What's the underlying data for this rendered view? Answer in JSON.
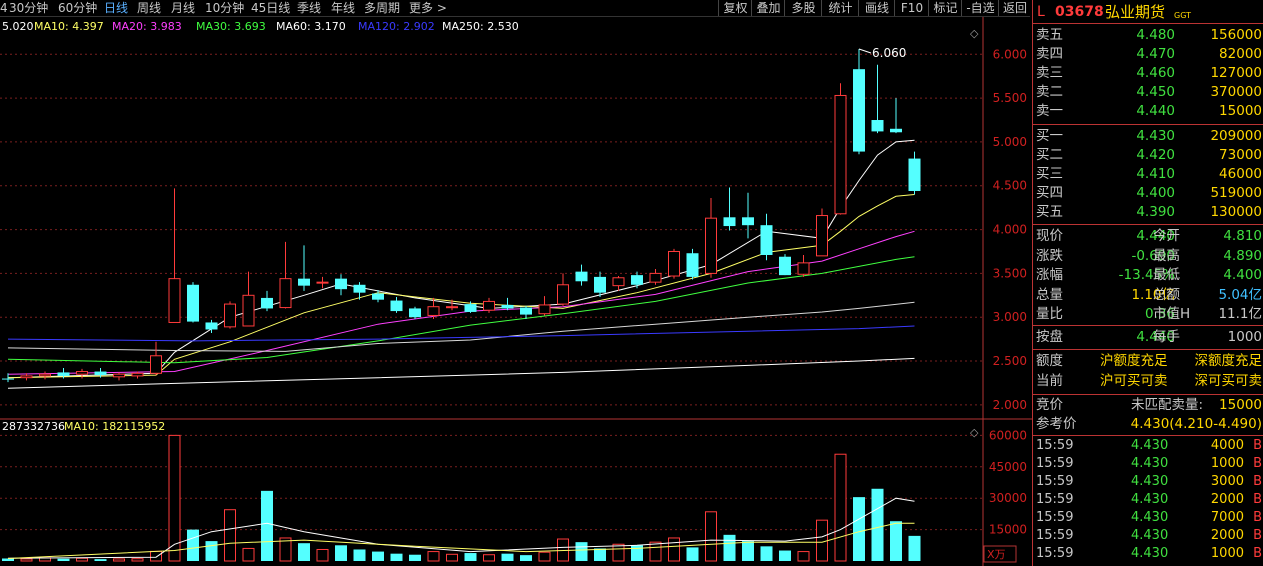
{
  "toolbar": {
    "periods": [
      "4",
      "30分钟",
      "60分钟",
      "日线",
      "周线",
      "月线",
      "10分钟",
      "45日线",
      "季线",
      "年线",
      "多周期",
      "更多 >"
    ],
    "active_period": "日线",
    "buttons": [
      "复权",
      "叠加",
      "多股",
      "统计",
      "画线",
      "F10",
      "标记",
      "-自选",
      "返回"
    ]
  },
  "chart_data": {
    "type": "candlestick",
    "ma_legend": [
      {
        "label": "5.020",
        "color": "#ffffff"
      },
      {
        "label": "MA10: 4.397",
        "color": "#ffff66"
      },
      {
        "label": "MA20: 3.983",
        "color": "#ff40ff"
      },
      {
        "label": "MA30: 3.693",
        "color": "#40ff40"
      },
      {
        "label": "MA60: 3.170",
        "color": "#ffffff"
      },
      {
        "label": "MA120: 2.902",
        "color": "#3a3aff"
      },
      {
        "label": "MA250: 2.530",
        "color": "#ffffff"
      }
    ],
    "price_ticks": [
      "6.000",
      "5.500",
      "5.000",
      "4.500",
      "4.000",
      "3.500",
      "3.000",
      "2.500",
      "2.000"
    ],
    "price_range": [
      1.85,
      6.22
    ],
    "high_label": "6.060",
    "candles": [
      {
        "o": 2.3,
        "h": 2.36,
        "l": 2.26,
        "c": 2.29
      },
      {
        "o": 2.31,
        "h": 2.36,
        "l": 2.28,
        "c": 2.33
      },
      {
        "o": 2.33,
        "h": 2.38,
        "l": 2.29,
        "c": 2.35
      },
      {
        "o": 2.37,
        "h": 2.42,
        "l": 2.3,
        "c": 2.33
      },
      {
        "o": 2.35,
        "h": 2.41,
        "l": 2.3,
        "c": 2.38
      },
      {
        "o": 2.38,
        "h": 2.42,
        "l": 2.31,
        "c": 2.34
      },
      {
        "o": 2.32,
        "h": 2.37,
        "l": 2.28,
        "c": 2.35
      },
      {
        "o": 2.33,
        "h": 2.38,
        "l": 2.3,
        "c": 2.36
      },
      {
        "o": 2.36,
        "h": 2.72,
        "l": 2.34,
        "c": 2.56
      },
      {
        "o": 2.94,
        "h": 4.47,
        "l": 2.94,
        "c": 3.44
      },
      {
        "o": 3.37,
        "h": 3.4,
        "l": 2.94,
        "c": 2.95
      },
      {
        "o": 2.94,
        "h": 2.97,
        "l": 2.82,
        "c": 2.86
      },
      {
        "o": 2.89,
        "h": 3.18,
        "l": 2.87,
        "c": 3.15
      },
      {
        "o": 2.9,
        "h": 3.52,
        "l": 2.9,
        "c": 3.25
      },
      {
        "o": 3.22,
        "h": 3.3,
        "l": 3.07,
        "c": 3.1
      },
      {
        "o": 3.11,
        "h": 3.86,
        "l": 3.1,
        "c": 3.44
      },
      {
        "o": 3.44,
        "h": 3.82,
        "l": 3.3,
        "c": 3.36
      },
      {
        "o": 3.4,
        "h": 3.46,
        "l": 3.33,
        "c": 3.4
      },
      {
        "o": 3.44,
        "h": 3.49,
        "l": 3.25,
        "c": 3.32
      },
      {
        "o": 3.37,
        "h": 3.4,
        "l": 3.2,
        "c": 3.28
      },
      {
        "o": 3.27,
        "h": 3.31,
        "l": 3.17,
        "c": 3.2
      },
      {
        "o": 3.19,
        "h": 3.23,
        "l": 3.05,
        "c": 3.07
      },
      {
        "o": 3.1,
        "h": 3.12,
        "l": 2.98,
        "c": 3.0
      },
      {
        "o": 3.02,
        "h": 3.22,
        "l": 2.98,
        "c": 3.12
      },
      {
        "o": 3.12,
        "h": 3.2,
        "l": 3.08,
        "c": 3.12
      },
      {
        "o": 3.15,
        "h": 3.18,
        "l": 3.05,
        "c": 3.06
      },
      {
        "o": 3.08,
        "h": 3.22,
        "l": 3.05,
        "c": 3.18
      },
      {
        "o": 3.14,
        "h": 3.22,
        "l": 3.08,
        "c": 3.1
      },
      {
        "o": 3.11,
        "h": 3.13,
        "l": 2.98,
        "c": 3.03
      },
      {
        "o": 3.04,
        "h": 3.24,
        "l": 3.02,
        "c": 3.14
      },
      {
        "o": 3.15,
        "h": 3.5,
        "l": 3.13,
        "c": 3.37
      },
      {
        "o": 3.52,
        "h": 3.6,
        "l": 3.36,
        "c": 3.41
      },
      {
        "o": 3.46,
        "h": 3.52,
        "l": 3.23,
        "c": 3.28
      },
      {
        "o": 3.36,
        "h": 3.47,
        "l": 3.3,
        "c": 3.45
      },
      {
        "o": 3.48,
        "h": 3.52,
        "l": 3.33,
        "c": 3.37
      },
      {
        "o": 3.4,
        "h": 3.55,
        "l": 3.37,
        "c": 3.5
      },
      {
        "o": 3.47,
        "h": 3.78,
        "l": 3.44,
        "c": 3.75
      },
      {
        "o": 3.73,
        "h": 3.78,
        "l": 3.43,
        "c": 3.46
      },
      {
        "o": 3.5,
        "h": 4.36,
        "l": 3.45,
        "c": 4.13
      },
      {
        "o": 4.14,
        "h": 4.48,
        "l": 3.99,
        "c": 4.04
      },
      {
        "o": 4.14,
        "h": 4.42,
        "l": 3.9,
        "c": 4.05
      },
      {
        "o": 4.05,
        "h": 4.18,
        "l": 3.65,
        "c": 3.71
      },
      {
        "o": 3.69,
        "h": 3.72,
        "l": 3.48,
        "c": 3.48
      },
      {
        "o": 3.49,
        "h": 3.71,
        "l": 3.46,
        "c": 3.62
      },
      {
        "o": 3.7,
        "h": 4.24,
        "l": 3.7,
        "c": 4.16
      },
      {
        "o": 4.18,
        "h": 5.67,
        "l": 4.17,
        "c": 5.53
      },
      {
        "o": 5.83,
        "h": 6.06,
        "l": 4.86,
        "c": 4.89
      },
      {
        "o": 5.25,
        "h": 5.88,
        "l": 5.1,
        "c": 5.12
      },
      {
        "o": 5.15,
        "h": 5.5,
        "l": 5.1,
        "c": 5.11
      },
      {
        "o": 4.81,
        "h": 4.89,
        "l": 4.4,
        "c": 4.44
      }
    ],
    "ma_lines": [
      {
        "color": "#ffffff",
        "pts": [
          [
            0,
            2.31
          ],
          [
            8,
            2.36
          ],
          [
            9,
            2.6
          ],
          [
            12,
            3.0
          ],
          [
            16,
            3.25
          ],
          [
            18,
            3.38
          ],
          [
            22,
            3.22
          ],
          [
            26,
            3.1
          ],
          [
            30,
            3.15
          ],
          [
            34,
            3.36
          ],
          [
            38,
            3.6
          ],
          [
            41,
            3.98
          ],
          [
            44,
            3.9
          ],
          [
            45,
            4.25
          ],
          [
            46,
            4.56
          ],
          [
            47,
            4.85
          ],
          [
            48,
            5.0
          ],
          [
            49,
            5.02
          ]
        ]
      },
      {
        "color": "#ffff66",
        "pts": [
          [
            0,
            2.31
          ],
          [
            8,
            2.34
          ],
          [
            9,
            2.52
          ],
          [
            12,
            2.72
          ],
          [
            16,
            3.05
          ],
          [
            20,
            3.28
          ],
          [
            25,
            3.16
          ],
          [
            30,
            3.1
          ],
          [
            34,
            3.28
          ],
          [
            38,
            3.5
          ],
          [
            41,
            3.74
          ],
          [
            44,
            3.82
          ],
          [
            45,
            3.98
          ],
          [
            46,
            4.15
          ],
          [
            47,
            4.27
          ],
          [
            48,
            4.38
          ],
          [
            49,
            4.4
          ]
        ]
      },
      {
        "color": "#ff40ff",
        "pts": [
          [
            0,
            2.35
          ],
          [
            9,
            2.38
          ],
          [
            14,
            2.62
          ],
          [
            20,
            2.92
          ],
          [
            25,
            3.07
          ],
          [
            30,
            3.12
          ],
          [
            35,
            3.26
          ],
          [
            40,
            3.52
          ],
          [
            44,
            3.64
          ],
          [
            46,
            3.78
          ],
          [
            48,
            3.92
          ],
          [
            49,
            3.98
          ]
        ]
      },
      {
        "color": "#40ff40",
        "pts": [
          [
            0,
            2.52
          ],
          [
            9,
            2.48
          ],
          [
            14,
            2.54
          ],
          [
            20,
            2.73
          ],
          [
            25,
            2.91
          ],
          [
            30,
            3.04
          ],
          [
            35,
            3.18
          ],
          [
            40,
            3.39
          ],
          [
            44,
            3.5
          ],
          [
            46,
            3.58
          ],
          [
            48,
            3.66
          ],
          [
            49,
            3.69
          ]
        ]
      },
      {
        "color": "#d8d8d8",
        "pts": [
          [
            0,
            2.65
          ],
          [
            9,
            2.62
          ],
          [
            15,
            2.61
          ],
          [
            20,
            2.7
          ],
          [
            25,
            2.74
          ],
          [
            30,
            2.84
          ],
          [
            35,
            2.92
          ],
          [
            40,
            3.0
          ],
          [
            44,
            3.06
          ],
          [
            46,
            3.1
          ],
          [
            49,
            3.17
          ]
        ]
      },
      {
        "color": "#3a3aff",
        "pts": [
          [
            0,
            2.75
          ],
          [
            10,
            2.73
          ],
          [
            20,
            2.75
          ],
          [
            30,
            2.79
          ],
          [
            40,
            2.84
          ],
          [
            46,
            2.87
          ],
          [
            49,
            2.9
          ]
        ]
      },
      {
        "color": "#ffffff",
        "pts": [
          [
            0,
            2.19
          ],
          [
            10,
            2.25
          ],
          [
            20,
            2.31
          ],
          [
            30,
            2.37
          ],
          [
            40,
            2.45
          ],
          [
            46,
            2.5
          ],
          [
            49,
            2.53
          ]
        ]
      }
    ],
    "vol_legend": [
      {
        "label": "287332736",
        "color": "#ffffff"
      },
      {
        "label": "MA10: 182115952",
        "color": "#ffff66"
      }
    ],
    "vol_ticks": [
      "60000",
      "45000",
      "30000",
      "15000"
    ],
    "vol_unit": "X万",
    "vol_range": [
      0,
      64000
    ],
    "volumes": [
      1200,
      1000,
      1500,
      1100,
      1300,
      900,
      1000,
      1100,
      4600,
      60000,
      15000,
      9500,
      24500,
      6000,
      33500,
      11000,
      8500,
      5500,
      7500,
      5500,
      4500,
      3500,
      3000,
      4500,
      3200,
      3800,
      3000,
      3500,
      2800,
      4200,
      10500,
      9000,
      6000,
      8000,
      7500,
      9000,
      11000,
      6500,
      23500,
      12500,
      9500,
      7000,
      5000,
      4500,
      19500,
      51000,
      30500,
      34500,
      19000,
      12000
    ],
    "vol_ma": [
      [
        0,
        1300
      ],
      [
        8,
        1800
      ],
      [
        9,
        8000
      ],
      [
        11,
        14000
      ],
      [
        14,
        18000
      ],
      [
        16,
        14000
      ],
      [
        20,
        8000
      ],
      [
        25,
        4500
      ],
      [
        30,
        6500
      ],
      [
        34,
        7500
      ],
      [
        38,
        10000
      ],
      [
        42,
        9500
      ],
      [
        44,
        11500
      ],
      [
        45,
        15000
      ],
      [
        46,
        20000
      ],
      [
        47,
        25000
      ],
      [
        48,
        30000
      ],
      [
        49,
        28500
      ]
    ],
    "vol_ma2": [
      [
        0,
        1200
      ],
      [
        9,
        5000
      ],
      [
        12,
        8500
      ],
      [
        16,
        10000
      ],
      [
        22,
        7000
      ],
      [
        28,
        4500
      ],
      [
        34,
        6000
      ],
      [
        40,
        9000
      ],
      [
        44,
        9000
      ],
      [
        46,
        14000
      ],
      [
        48,
        18000
      ],
      [
        49,
        18000
      ]
    ]
  },
  "quote": {
    "prefix": "L",
    "code": "03678",
    "name": "弘业期货",
    "tag": "GGT",
    "asks": [
      {
        "label": "卖五",
        "price": "4.480",
        "vol": "156000"
      },
      {
        "label": "卖四",
        "price": "4.470",
        "vol": "82000"
      },
      {
        "label": "卖三",
        "price": "4.460",
        "vol": "127000"
      },
      {
        "label": "卖二",
        "price": "4.450",
        "vol": "370000"
      },
      {
        "label": "卖一",
        "price": "4.440",
        "vol": "15000"
      }
    ],
    "bids": [
      {
        "label": "买一",
        "price": "4.430",
        "vol": "209000"
      },
      {
        "label": "买二",
        "price": "4.420",
        "vol": "73000"
      },
      {
        "label": "买三",
        "price": "4.410",
        "vol": "46000"
      },
      {
        "label": "买四",
        "price": "4.400",
        "vol": "519000"
      },
      {
        "label": "买五",
        "price": "4.390",
        "vol": "130000"
      }
    ],
    "stats": [
      {
        "l1": "现价",
        "v1": "4.440",
        "l2": "今开",
        "v2": "4.810",
        "c1": "#40e040",
        "c2": "#40e040"
      },
      {
        "l1": "涨跌",
        "v1": "-0.690",
        "l2": "最高",
        "v2": "4.890",
        "c1": "#40e040",
        "c2": "#40e040"
      },
      {
        "l1": "涨幅",
        "v1": "-13.45%",
        "l2": "最低",
        "v2": "4.400",
        "c1": "#40e040",
        "c2": "#40e040"
      },
      {
        "l1": "总量",
        "v1": "1.10亿",
        "l2": "总额",
        "v2": "5.04亿",
        "c1": "#ffd700",
        "c2": "#40c0ff"
      },
      {
        "l1": "量比",
        "v1": "0.36",
        "l2": "市值H",
        "v2": "11.1亿",
        "c1": "#40e040",
        "c2": "#c8c8c8"
      }
    ],
    "lot": {
      "l1": "按盘",
      "v1": "4.440",
      "l2": "每手",
      "v2": "1000"
    },
    "quota": {
      "l1": "额度",
      "v1": "沪额度充足",
      "v2": "深额度充足"
    },
    "current": {
      "l1": "当前",
      "v1": "沪可买可卖",
      "v2": "深可买可卖"
    },
    "auction": {
      "l1": "竞价",
      "v1": "未匹配卖量:",
      "v2": "15000"
    },
    "ref": {
      "l1": "参考价",
      "v1": "4.430(4.210-4.490)"
    },
    "ticks": [
      {
        "time": "15:59",
        "price": "4.430",
        "vol": "4000",
        "side": "B"
      },
      {
        "time": "15:59",
        "price": "4.430",
        "vol": "1000",
        "side": "B"
      },
      {
        "time": "15:59",
        "price": "4.430",
        "vol": "3000",
        "side": "B"
      },
      {
        "time": "15:59",
        "price": "4.430",
        "vol": "2000",
        "side": "B"
      },
      {
        "time": "15:59",
        "price": "4.430",
        "vol": "7000",
        "side": "B"
      },
      {
        "time": "15:59",
        "price": "4.430",
        "vol": "2000",
        "side": "B"
      },
      {
        "time": "15:59",
        "price": "4.430",
        "vol": "1000",
        "side": "B"
      }
    ],
    "colors": {
      "up": "#ff3b3b",
      "down": "#54ffff",
      "green": "#40e040",
      "yellow": "#ffd700",
      "border": "#b33333"
    }
  }
}
